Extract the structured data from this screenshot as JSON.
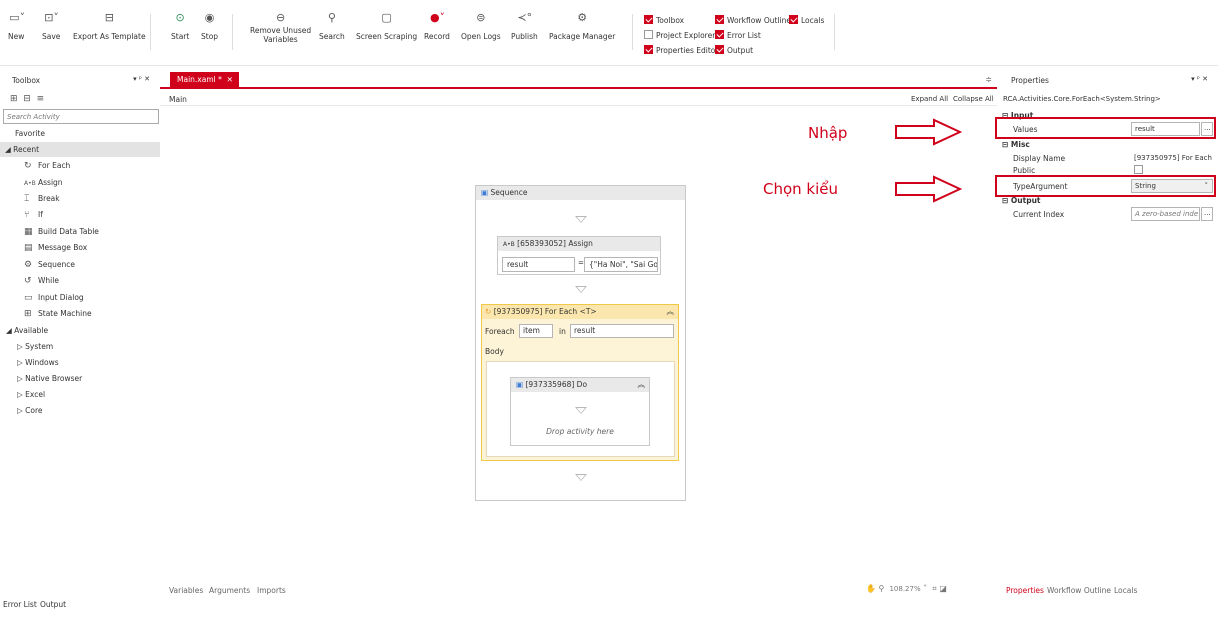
{
  "ribbon": {
    "new": "New",
    "save": "Save",
    "export_template": "Export As Template",
    "start": "Start",
    "stop": "Stop",
    "remove_unused_1": "Remove Unused",
    "remove_unused_2": "Variables",
    "search": "Search",
    "screen_scraping": "Screen Scraping",
    "record": "Record",
    "open_logs": "Open Logs",
    "publish": "Publish",
    "package_manager": "Package Manager",
    "checks": {
      "toolbox": "Toolbox",
      "project_explorer": "Project Explorer",
      "properties_editor": "Properties Editor",
      "workflow_outline": "Workflow Outline",
      "locals": "Locals",
      "error_list": "Error List",
      "output": "Output"
    }
  },
  "toolbox": {
    "title": "Toolbox",
    "pin": "▾ ᵖ ✕",
    "search_placeholder": "Search Activity",
    "favorite": "Favorite",
    "recent": "Recent",
    "recent_items": [
      "For Each",
      "Assign",
      "Break",
      "If",
      "Build Data Table",
      "Message Box",
      "Sequence",
      "While",
      "Input Dialog",
      "State Machine"
    ],
    "available": "Available",
    "available_items": [
      "System",
      "Windows",
      "Native Browser",
      "Excel",
      "Core"
    ]
  },
  "editor": {
    "tab": "Main.xaml *",
    "breadcrumb": "Main",
    "expand_all": "Expand All",
    "collapse_all": "Collapse All",
    "sequence_title": "Sequence",
    "assign_title": "[658393052] Assign",
    "assign_to": "result",
    "assign_value": "{\"Ha Noi\", \"Sai Gor",
    "foreach_title": "[937350975] For Each <T>",
    "foreach_label": "Foreach",
    "foreach_item": "item",
    "foreach_in": "in",
    "foreach_values": "result",
    "body_label": "Body",
    "do_title": "[937335968] Do",
    "drop_hint": "Drop activity here",
    "bottom_tabs": [
      "Variables",
      "Arguments",
      "Imports"
    ],
    "zoom": "108.27%"
  },
  "properties": {
    "title": "Properties",
    "type_name": "RCA.Activities.Core.ForEach<System.String>",
    "sections": {
      "input": "Input",
      "misc": "Misc",
      "output": "Output"
    },
    "values_label": "Values",
    "values_value": "result",
    "display_name_label": "Display Name",
    "display_name_value": "[937350975] For Each <",
    "public_label": "Public",
    "type_argument_label": "TypeArgument",
    "type_argument_value": "String",
    "current_index_label": "Current Index",
    "current_index_placeholder": "A zero-based inde",
    "bottom_tabs": [
      "Properties",
      "Workflow Outline",
      "Locals"
    ]
  },
  "annotations": {
    "nhap": "Nhập",
    "chon_kieu": "Chọn kiểu"
  },
  "statusbar": {
    "error_list": "Error List",
    "output": "Output"
  },
  "colors": {
    "accent": "#d0021b",
    "foreach_bg": "#fdf3d6",
    "foreach_border": "#f0c94a"
  }
}
